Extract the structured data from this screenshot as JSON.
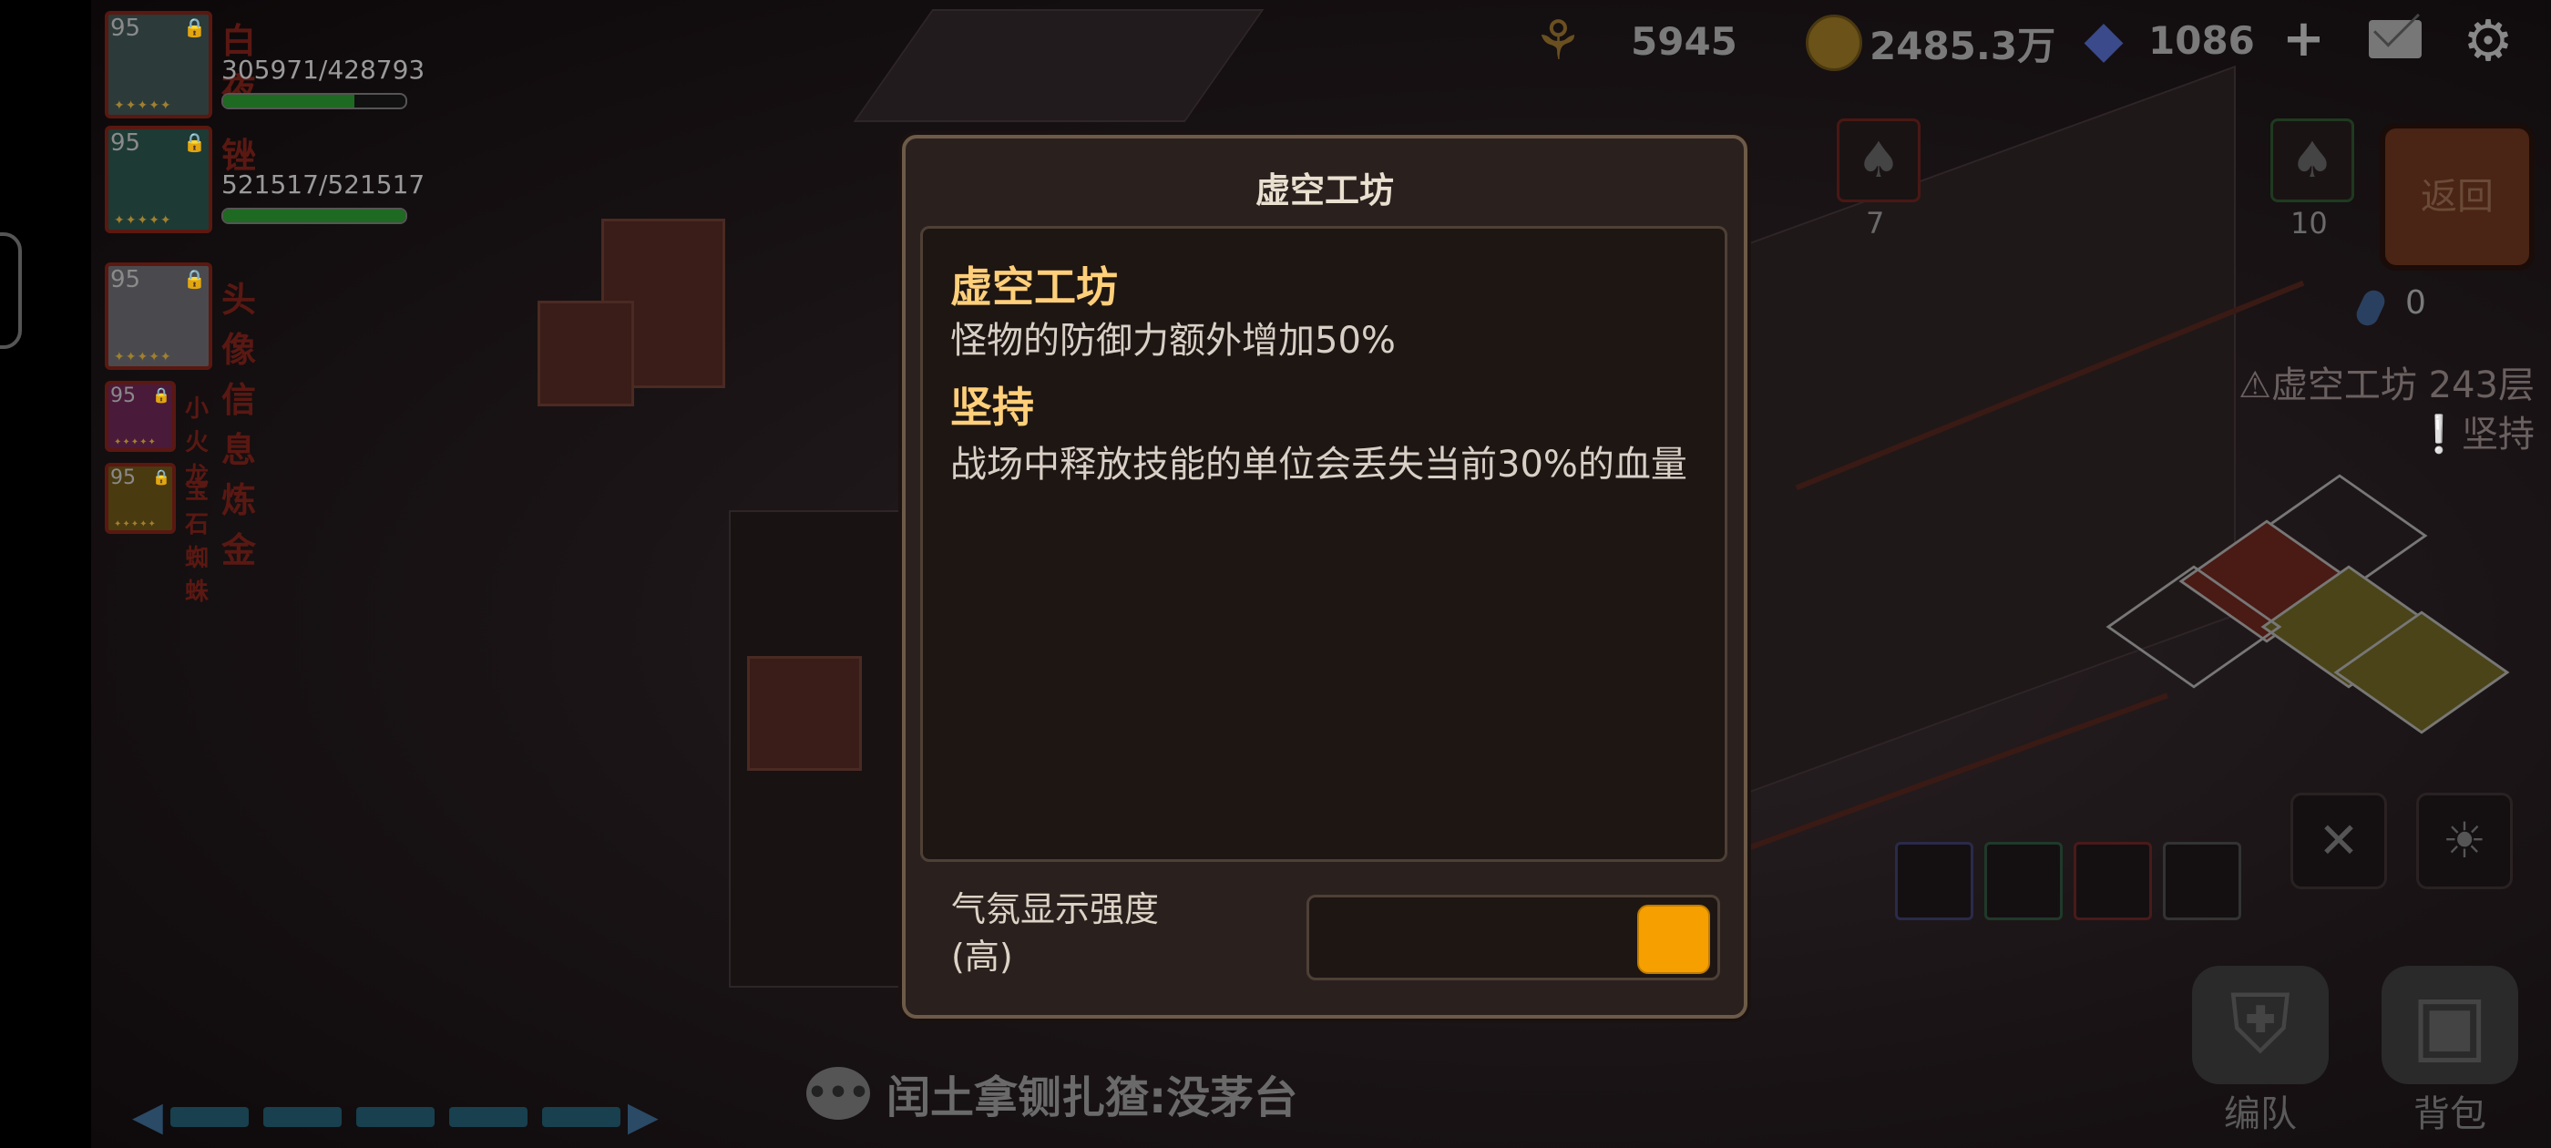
{
  "heroes": [
    {
      "level": "95",
      "name": "白夜",
      "hp": "305971/428793",
      "hp_fraction": 0.72
    },
    {
      "level": "95",
      "name": "锉",
      "hp": "521517/521517",
      "hp_fraction": 1.0
    },
    {
      "level": "95",
      "name": "头像信息炼金"
    },
    {
      "level": "95",
      "name": "小火龙"
    },
    {
      "level": "95",
      "name": "宝石蜘蛛"
    }
  ],
  "resources": {
    "wheat": "5945",
    "gold": "2485.3万",
    "gems": "1086"
  },
  "right_panel": {
    "crystal_red_count": "7",
    "crystal_green_count": "10",
    "back_label": "返回",
    "feather_count": "0",
    "floor_warning": "⚠虚空工坊 243层",
    "modifier": "❕坚持"
  },
  "bottom": {
    "chat_text": "闰土拿铡扎猹:没茅台",
    "team_label": "编队",
    "bag_label": "背包"
  },
  "modal": {
    "title": "虚空工坊",
    "sections": [
      {
        "title": "虚空工坊",
        "desc": "怪物的防御力额外增加50%"
      },
      {
        "title": "坚持",
        "desc": "战场中释放技能的单位会丢失当前30%的血量"
      }
    ],
    "mood_label_line1": "气氛显示强度",
    "mood_label_line2": "(高)"
  },
  "colors": {
    "accent": "#f5a000",
    "section_title": "#ffcf7a",
    "hp_bar": "#1f6a22"
  }
}
